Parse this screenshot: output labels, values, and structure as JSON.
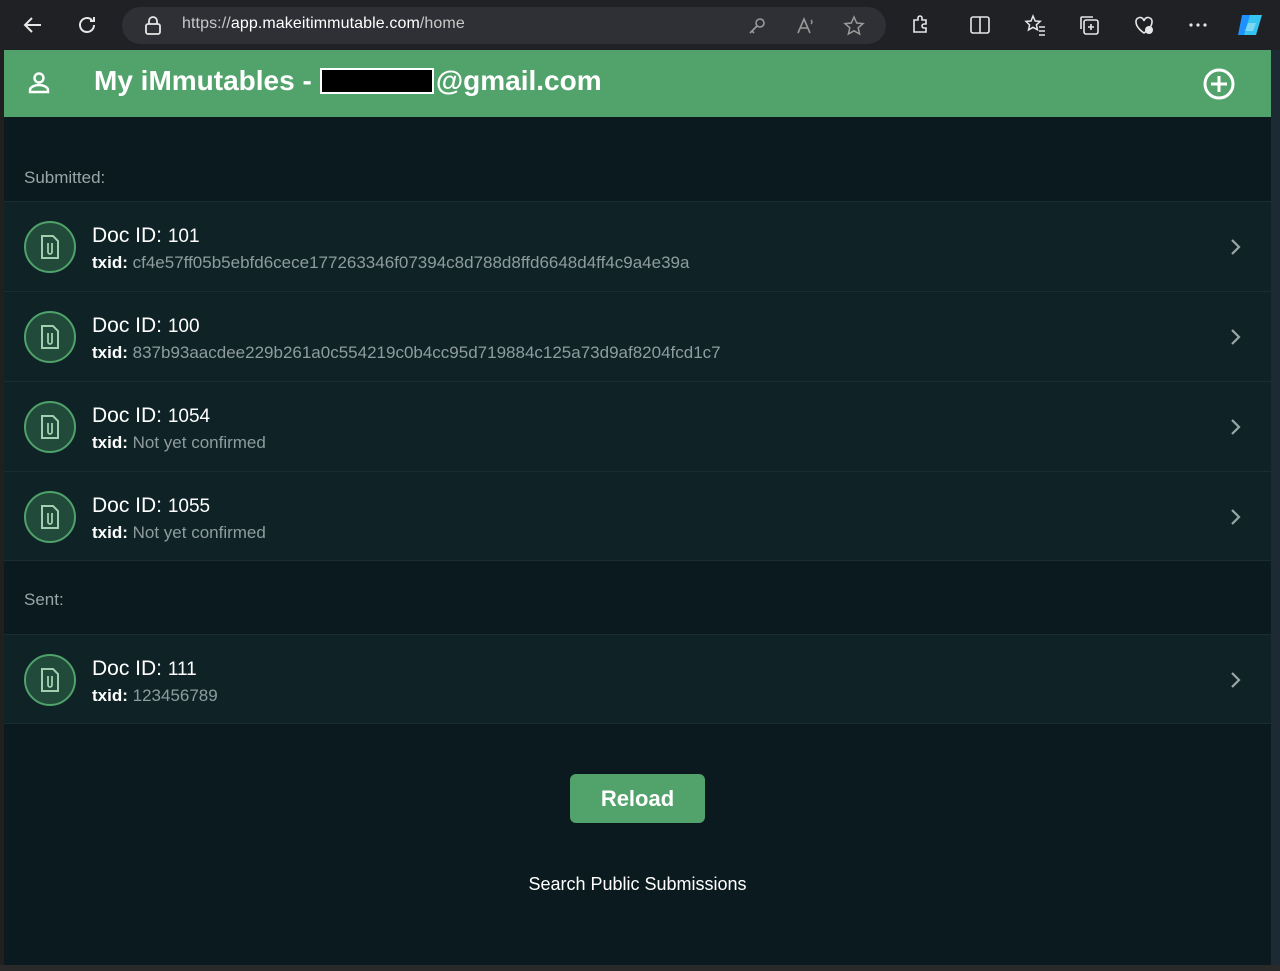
{
  "browser": {
    "url_prefix": "https://",
    "url_host": "app.makeitimmutable.com",
    "url_path": "/home"
  },
  "header": {
    "title_prefix": "My iMmutables -",
    "email_suffix": "@gmail.com"
  },
  "sections": {
    "submitted_label": "Submitted:",
    "sent_label": "Sent:"
  },
  "labels": {
    "doc_id": "Doc ID:",
    "txid": "txid:"
  },
  "submitted": [
    {
      "doc_id": "101",
      "txid": "cf4e57ff05b5ebfd6cece177263346f07394c8d788d8ffd6648d4ff4c9a4e39a"
    },
    {
      "doc_id": "100",
      "txid": "837b93aacdee229b261a0c554219c0b4cc95d719884c125a73d9af8204fcd1c7"
    },
    {
      "doc_id": "1054",
      "txid": "Not yet confirmed"
    },
    {
      "doc_id": "1055",
      "txid": "Not yet confirmed"
    }
  ],
  "sent": [
    {
      "doc_id": "111",
      "txid": "123456789"
    }
  ],
  "actions": {
    "reload_label": "Reload",
    "search_label": "Search Public Submissions"
  },
  "colors": {
    "accent": "#52a36b",
    "background": "#0b1a1e",
    "row": "#0f2327"
  },
  "icons": {
    "user": "user-icon",
    "add": "add-circle-icon",
    "doc": "attachment-doc-icon",
    "chevron": "chevron-right-icon"
  }
}
